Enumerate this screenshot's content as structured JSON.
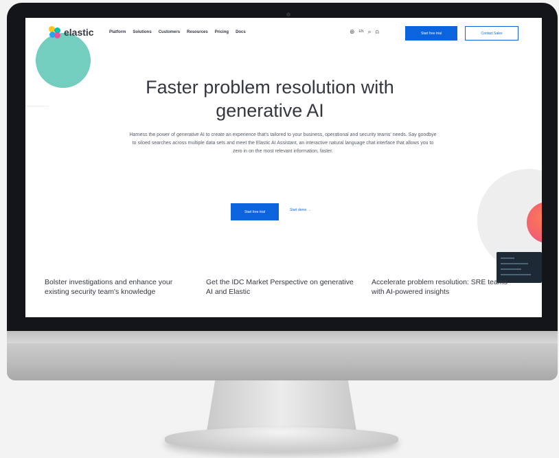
{
  "nav": {
    "logo_text": "elastic",
    "links": [
      "Platform",
      "Solutions",
      "Customers",
      "Resources",
      "Pricing",
      "Docs"
    ],
    "language": "EN",
    "trial_button": "Start free trial",
    "contact_button": "Contact Sales"
  },
  "hero": {
    "title_line1": "Faster problem resolution with",
    "title_line2": "generative AI",
    "description": "Harness the power of generative AI to create an experience that's tailored to your business, operational and security teams' needs. Say goodbye to siloed searches across multiple data sets and meet the Elastic AI Assistant, an interactive natural language chat interface that allows you to zero in on the most relevant information, faster.",
    "primary_button": "Start free trial",
    "secondary_link": "Start demo →"
  },
  "cards": [
    {
      "text": "Bolster investigations and enhance your existing security team's knowledge"
    },
    {
      "text": "Get the IDC Market Perspective on generative AI and Elastic"
    },
    {
      "text": "Accelerate problem resolution: SRE teams with AI-powered insights"
    }
  ],
  "colors": {
    "brand_blue": "#0b64dd",
    "text_dark": "#343741",
    "teal": "#5cc5b4"
  }
}
